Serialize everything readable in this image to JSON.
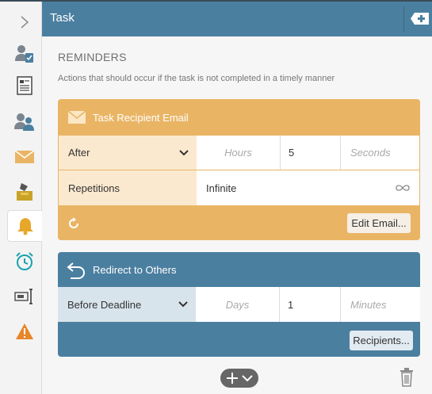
{
  "header": {
    "title": "Task"
  },
  "reminders": {
    "title": "REMINDERS",
    "description": "Actions that should occur if the task is not completed in a timely manner"
  },
  "cards": [
    {
      "title": "Task Recipient Email",
      "timing": {
        "selected": "After",
        "unit1_placeholder": "Hours",
        "value": "5",
        "unit2_placeholder": "Seconds"
      },
      "repetitions": {
        "label": "Repetitions",
        "value": "Infinite"
      },
      "button": "Edit Email..."
    },
    {
      "title": "Redirect to Others",
      "timing": {
        "selected": "Before Deadline",
        "unit1_placeholder": "Days",
        "value": "1",
        "unit2_placeholder": "Minutes"
      },
      "button": "Recipients..."
    }
  ],
  "rail": {
    "icons": [
      "expand-chevron-icon",
      "user-check-icon",
      "form-icon",
      "users-icon",
      "envelope-icon",
      "inbox-icon",
      "bell-icon",
      "alarm-clock-icon",
      "text-cursor-icon",
      "warning-icon"
    ],
    "active": "bell-icon"
  },
  "colors": {
    "header": "#4b7fa0",
    "email_card": "#e9b565",
    "redirect_card": "#4b7fa0",
    "rail_bg": "#f3f3f3"
  }
}
